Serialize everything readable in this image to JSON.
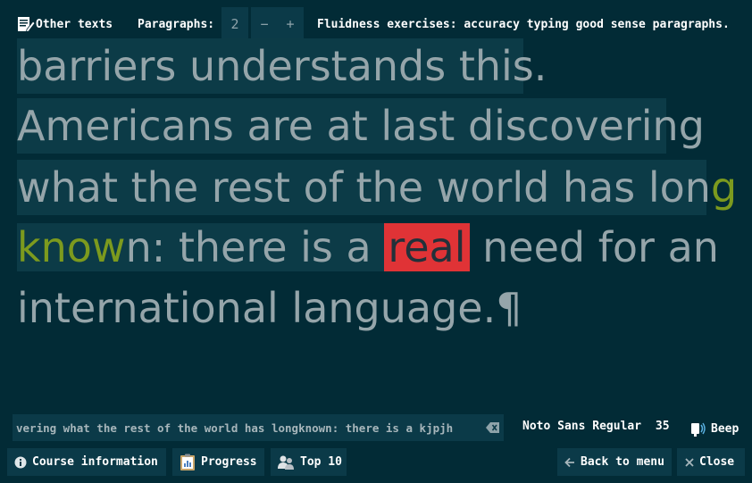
{
  "topbar": {
    "other_texts_label": "Other texts",
    "paragraphs_label": "Paragraphs:",
    "paragraphs_value": "2",
    "minus": "−",
    "plus": "+",
    "description": "Fluidness exercises: accuracy typing good sense paragraphs."
  },
  "text": {
    "line1": "barriers understands this.",
    "line2": "Americans are at last discovering",
    "line3_a": "what the rest of the world has lon",
    "line3_b": "g",
    "line4_a": "know",
    "line4_b": "n: there is a ",
    "line4_cur": "real",
    "line4_c": " need for an",
    "line5": "international language.",
    "pilcrow": "¶"
  },
  "input": {
    "value": "vering what the rest of the world has longknown: there is a kjpjh"
  },
  "status": {
    "font": "Noto Sans Regular",
    "size": "35",
    "beep": "Beep"
  },
  "buttons": {
    "course_info": "Course information",
    "progress": "Progress",
    "top10": "Top 10",
    "back": "Back to menu",
    "close": "Close"
  },
  "colors": {
    "background": "#022b36",
    "typed_highlight": "#0c3b47",
    "text": "#95a5aa",
    "partial_word": "#7c9a1e",
    "cursor_error": "#e03336"
  }
}
